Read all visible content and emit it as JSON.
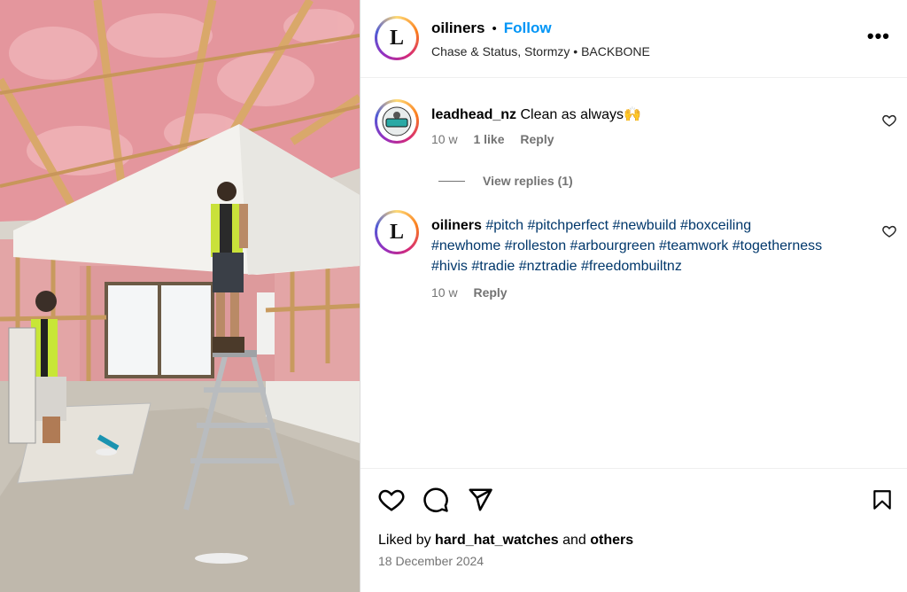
{
  "post": {
    "username": "oiliners",
    "dot": "•",
    "follow_label": "Follow",
    "audio": "Chase & Status, Stormzy • BACKBONE",
    "avatar_letter": "L"
  },
  "comments": [
    {
      "username": "leadhead_nz",
      "text": "Clean as always🙌",
      "time": "10 w",
      "likes": "1 like",
      "reply_label": "Reply"
    }
  ],
  "view_replies": "View replies (1)",
  "caption": {
    "username": "oiliners",
    "hashtags_line1": "#pitch #pitchperfect #newbuild #boxceiling",
    "hashtags_line2": "#newhome #rolleston #arbourgreen #teamwork #togetherness",
    "hashtags_line3": "#hivis #tradie #nztradie #freedombuiltnz",
    "time": "10 w",
    "reply_label": "Reply"
  },
  "footer": {
    "liked_prefix": "Liked by",
    "liked_user": "hard_hat_watches",
    "liked_and": "and",
    "liked_others": "others",
    "date": "18 December 2024"
  },
  "colors": {
    "accent": "#0095f6",
    "hashtag": "#00376b",
    "muted": "#737373"
  },
  "icons": [
    "more-options-icon",
    "heart-icon",
    "comment-icon",
    "share-icon",
    "bookmark-icon"
  ]
}
